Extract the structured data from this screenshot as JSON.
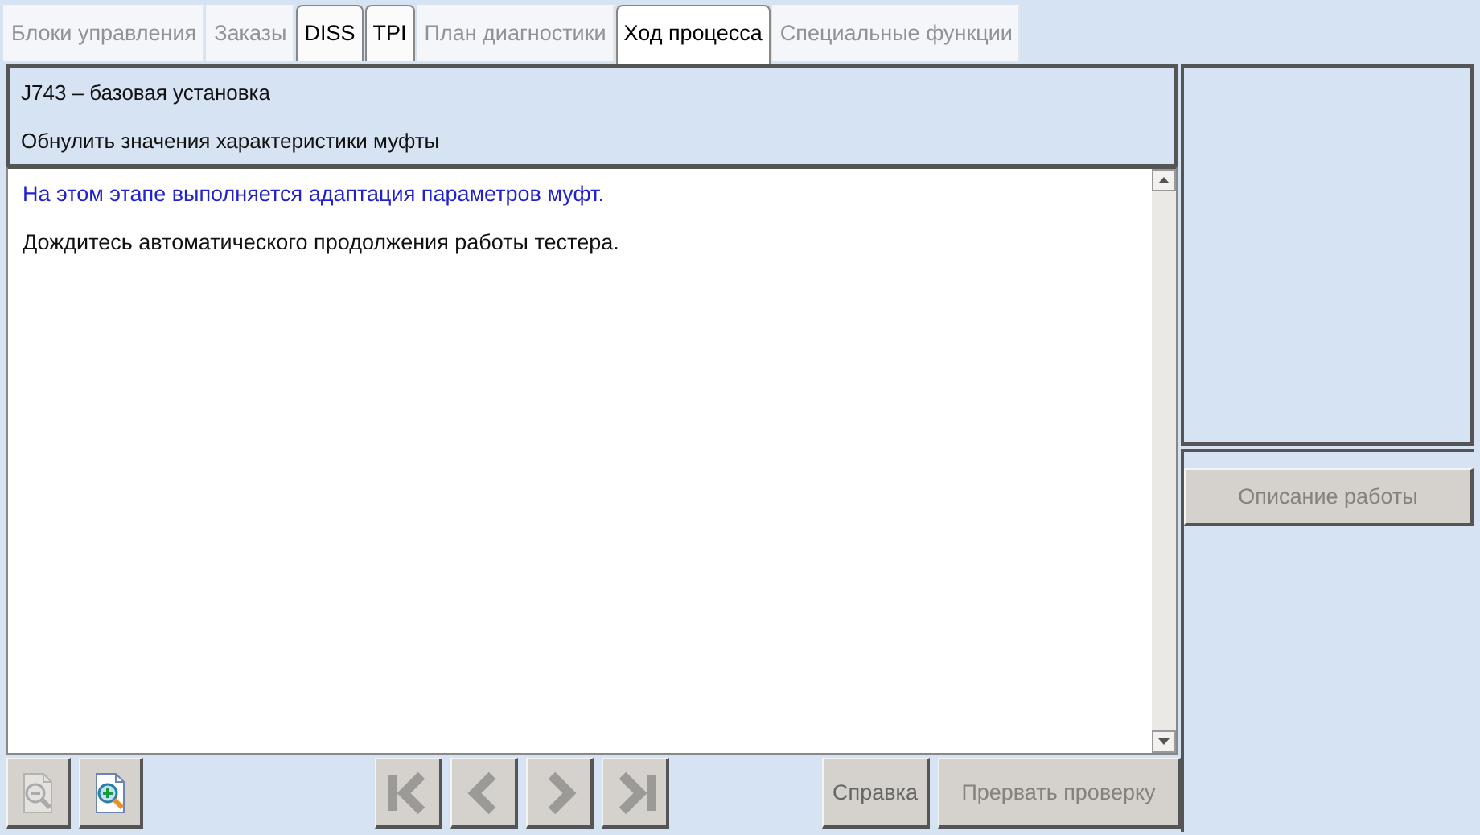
{
  "tabs": [
    {
      "label": "Блоки управления",
      "selected": false,
      "disabled": true
    },
    {
      "label": "Заказы",
      "selected": false,
      "disabled": true
    },
    {
      "label": "DISS",
      "selected": false,
      "disabled": false
    },
    {
      "label": "TPI",
      "selected": false,
      "disabled": false
    },
    {
      "label": "План диагностики",
      "selected": false,
      "disabled": true
    },
    {
      "label": "Ход процесса",
      "selected": true,
      "disabled": false
    },
    {
      "label": "Специальные функции",
      "selected": false,
      "disabled": true
    }
  ],
  "header": {
    "title": "J743 – базовая установка",
    "subtitle": "Обнулить значения характеристики муфты"
  },
  "messages": [
    {
      "kind": "info",
      "text": "На этом этапе выполняется адаптация параметров муфт."
    },
    {
      "kind": "plain",
      "text": "Дождитесь автоматического продолжения работы тестера."
    }
  ],
  "toolbar": {
    "zoom": [
      {
        "kind": "zoom-out",
        "disabled": true
      },
      {
        "kind": "zoom-in",
        "disabled": false
      }
    ],
    "navigation": [
      {
        "kind": "first",
        "disabled": true
      },
      {
        "kind": "previous",
        "disabled": true
      },
      {
        "kind": "next",
        "disabled": true
      },
      {
        "kind": "last",
        "disabled": true
      }
    ],
    "actions": [
      {
        "label": "Справка",
        "disabled": false
      },
      {
        "label": "Прервать проверку",
        "disabled": true
      }
    ]
  },
  "side_panel": {
    "button": {
      "label": "Описание работы",
      "disabled": true
    }
  }
}
